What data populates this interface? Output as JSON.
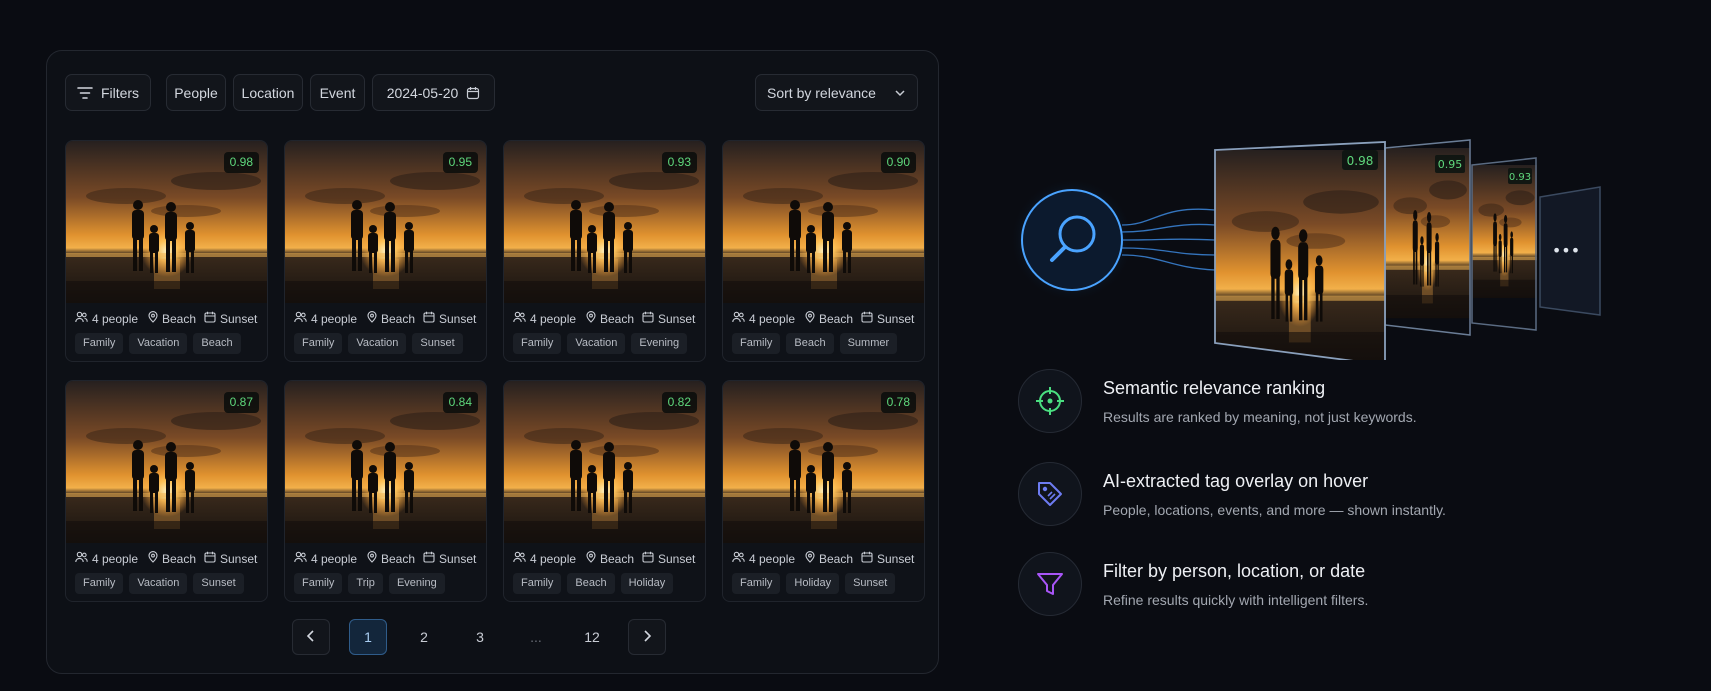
{
  "toolbar": {
    "filters_label": "Filters",
    "people_label": "People",
    "location_label": "Location",
    "event_label": "Event",
    "date_value": "2024-05-20",
    "sort_label": "Sort by relevance"
  },
  "results": [
    {
      "score": "0.98",
      "people": "4 people",
      "location": "Beach",
      "event": "Sunset",
      "tags": [
        "Family",
        "Vacation",
        "Beach"
      ]
    },
    {
      "score": "0.95",
      "people": "4 people",
      "location": "Beach",
      "event": "Sunset",
      "tags": [
        "Family",
        "Vacation",
        "Sunset"
      ]
    },
    {
      "score": "0.93",
      "people": "4 people",
      "location": "Beach",
      "event": "Sunset",
      "tags": [
        "Family",
        "Vacation",
        "Evening"
      ]
    },
    {
      "score": "0.90",
      "people": "4 people",
      "location": "Beach",
      "event": "Sunset",
      "tags": [
        "Family",
        "Beach",
        "Summer"
      ]
    },
    {
      "score": "0.87",
      "people": "4 people",
      "location": "Beach",
      "event": "Sunset",
      "tags": [
        "Family",
        "Vacation",
        "Sunset"
      ]
    },
    {
      "score": "0.84",
      "people": "4 people",
      "location": "Beach",
      "event": "Sunset",
      "tags": [
        "Family",
        "Trip",
        "Evening"
      ]
    },
    {
      "score": "0.82",
      "people": "4 people",
      "location": "Beach",
      "event": "Sunset",
      "tags": [
        "Family",
        "Beach",
        "Holiday"
      ]
    },
    {
      "score": "0.78",
      "people": "4 people",
      "location": "Beach",
      "event": "Sunset",
      "tags": [
        "Family",
        "Holiday",
        "Sunset"
      ]
    }
  ],
  "pagination": {
    "pages": [
      "1",
      "2",
      "3",
      "...",
      "12"
    ],
    "current": "1"
  },
  "illustration": {
    "scores": [
      "0.98",
      "0.95",
      "0.93"
    ],
    "more": "•••"
  },
  "features": [
    {
      "icon": "crosshair-icon",
      "color": "#4ade80",
      "title": "Semantic relevance ranking",
      "desc": "Results are ranked by meaning, not just keywords."
    },
    {
      "icon": "tag-icon",
      "color": "#6d7cf2",
      "title": "AI-extracted tag overlay on hover",
      "desc": "People, locations, events, and more — shown instantly."
    },
    {
      "icon": "funnel-icon",
      "color": "#a855f7",
      "title": "Filter by person, location, or date",
      "desc": "Refine results quickly with intelligent filters."
    }
  ],
  "colors": {
    "accent_green": "#5fd87c",
    "accent_blue": "#4aa3ff",
    "background": "#0a0c12"
  }
}
